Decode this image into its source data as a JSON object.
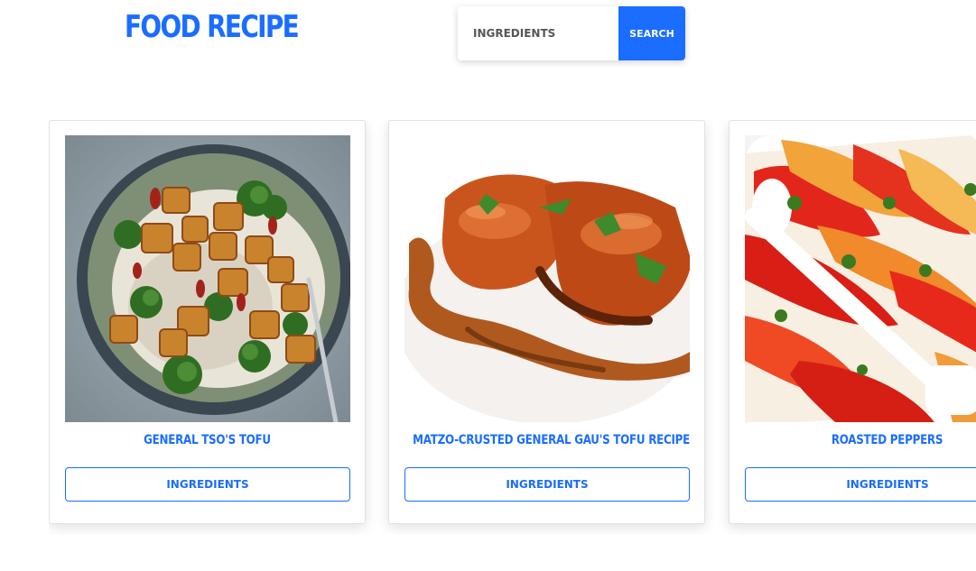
{
  "header": {
    "title": "FOOD RECIPE"
  },
  "search": {
    "placeholder": "INGREDIENTS",
    "value": "",
    "button_label": "SEARCH"
  },
  "recipes": [
    {
      "title": "GENERAL TSO'S TOFU",
      "button_label": "INGREDIENTS"
    },
    {
      "title": "MATZO-CRUSTED GENERAL GAU'S TOFU RECIPE",
      "button_label": "INGREDIENTS"
    },
    {
      "title": "ROASTED PEPPERS",
      "button_label": "INGREDIENTS"
    }
  ],
  "colors": {
    "accent": "#1a6dff",
    "background": "#ffffff",
    "card_border": "#e2e2e2"
  }
}
